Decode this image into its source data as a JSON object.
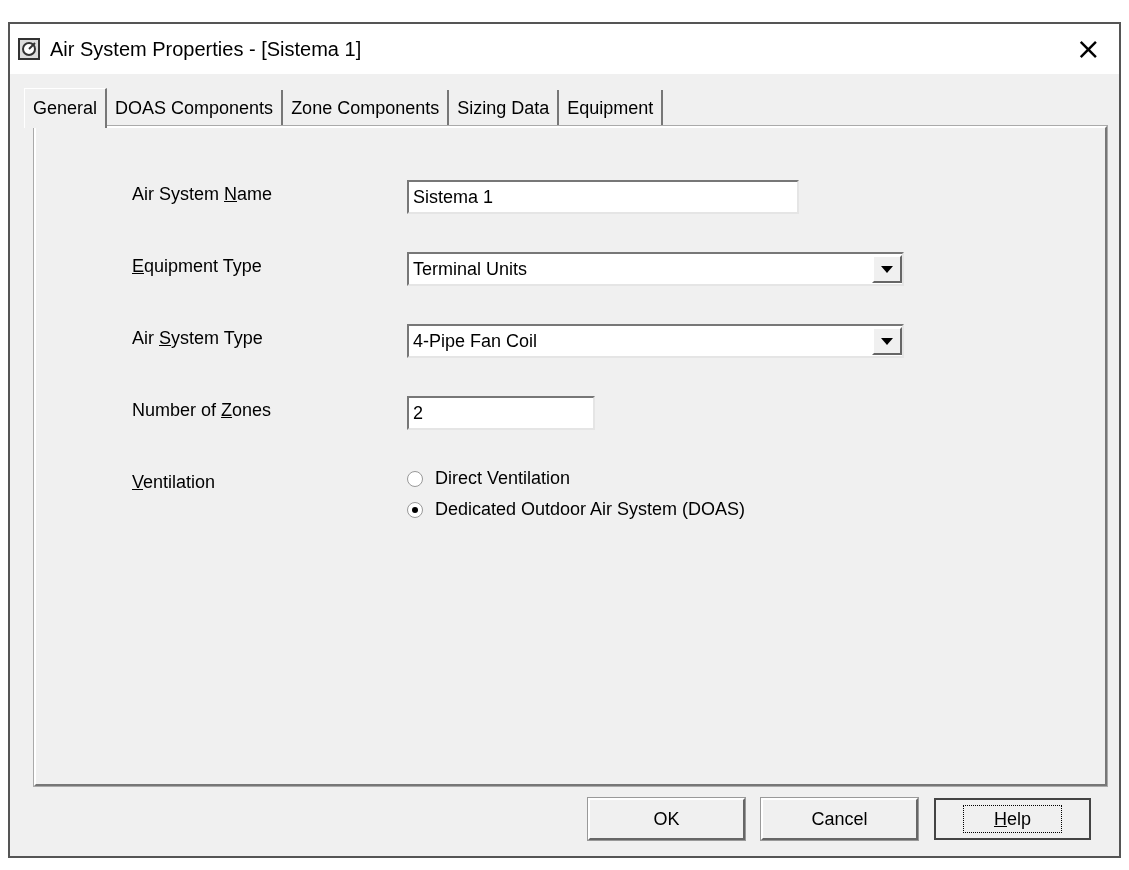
{
  "window": {
    "title": "Air System Properties - [Sistema 1]",
    "close": "×"
  },
  "tabs": [
    {
      "label": "General",
      "selected": true
    },
    {
      "label": "DOAS Components",
      "selected": false
    },
    {
      "label": "Zone Components",
      "selected": false
    },
    {
      "label": "Sizing Data",
      "selected": false
    },
    {
      "label": "Equipment",
      "selected": false
    }
  ],
  "fields": [
    {
      "kind": "text",
      "label": {
        "before": "Air System ",
        "key": "N",
        "after": "ame"
      },
      "value": "Sistema 1"
    },
    {
      "kind": "combo",
      "label": {
        "key": "E",
        "after": "quipment Type"
      },
      "value": "Terminal Units"
    },
    {
      "kind": "combo",
      "label": {
        "before": "Air ",
        "key": "S",
        "after": "ystem Type"
      },
      "value": "4-Pipe Fan Coil"
    },
    {
      "kind": "text",
      "label": {
        "before": "Number of ",
        "key": "Z",
        "after": "ones"
      },
      "value": "2"
    },
    {
      "kind": "radio",
      "label": {
        "key": "V",
        "after": "entilation"
      },
      "options": [
        {
          "label": "Direct Ventilation",
          "selected": false
        },
        {
          "label": "Dedicated Outdoor Air System (DOAS)",
          "selected": true
        }
      ]
    }
  ],
  "buttons": [
    {
      "label": {
        "before": "OK"
      },
      "focused": false
    },
    {
      "label": {
        "before": "Cancel"
      },
      "focused": false
    },
    {
      "label": {
        "key": "H",
        "after": "elp"
      },
      "focused": true
    }
  ]
}
